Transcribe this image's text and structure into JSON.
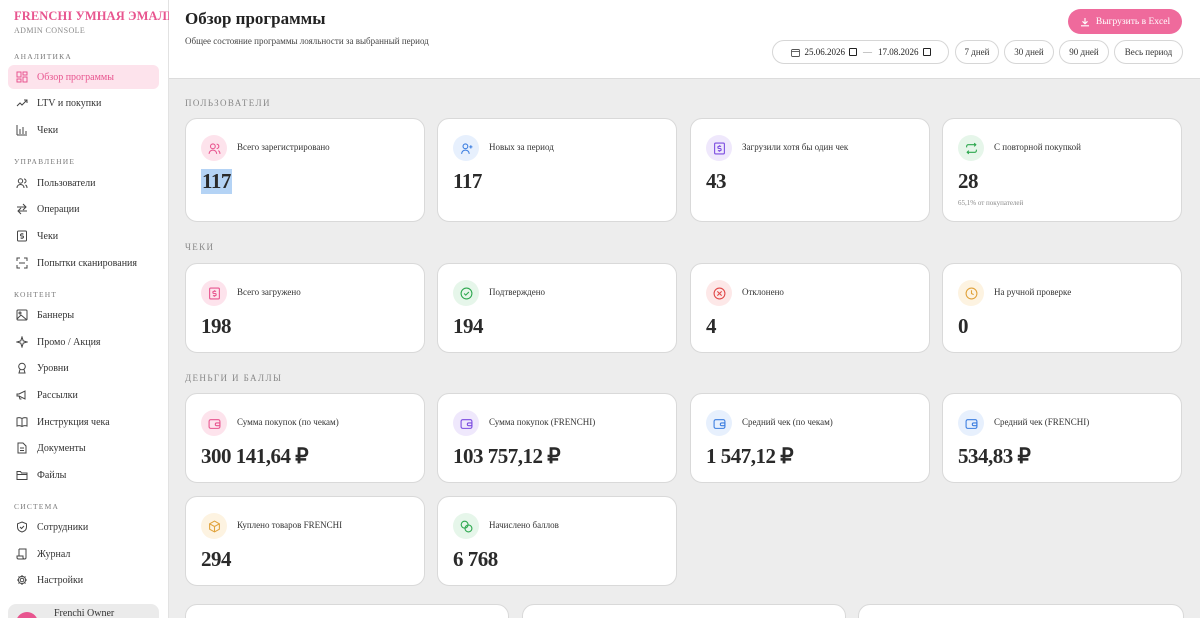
{
  "sidebar": {
    "brand": "FRENCHI УМНАЯ ЭМАЛЬ",
    "brand_sub": "ADMIN CONSOLE",
    "sections": [
      {
        "title": "АНАЛИТИКА",
        "items": [
          {
            "label": "Обзор программы",
            "icon": "dashboard-icon",
            "active": true
          },
          {
            "label": "LTV и покупки",
            "icon": "trend-up-icon"
          },
          {
            "label": "Чеки",
            "icon": "bar-chart-icon"
          }
        ]
      },
      {
        "title": "УПРАВЛЕНИЕ",
        "items": [
          {
            "label": "Пользователи",
            "icon": "users-icon"
          },
          {
            "label": "Операции",
            "icon": "arrows-swap-icon"
          },
          {
            "label": "Чеки",
            "icon": "receipt-icon"
          },
          {
            "label": "Попытки сканирования",
            "icon": "scan-icon"
          }
        ]
      },
      {
        "title": "КОНТЕНТ",
        "items": [
          {
            "label": "Баннеры",
            "icon": "image-icon"
          },
          {
            "label": "Промо / Акция",
            "icon": "sparkle-icon"
          },
          {
            "label": "Уровни",
            "icon": "award-icon"
          },
          {
            "label": "Рассылки",
            "icon": "megaphone-icon"
          },
          {
            "label": "Инструкция чека",
            "icon": "book-icon"
          },
          {
            "label": "Документы",
            "icon": "document-icon"
          },
          {
            "label": "Файлы",
            "icon": "folder-icon"
          }
        ]
      },
      {
        "title": "СИСТЕМА",
        "items": [
          {
            "label": "Сотрудники",
            "icon": "shield-icon"
          },
          {
            "label": "Журнал",
            "icon": "scroll-icon"
          },
          {
            "label": "Настройки",
            "icon": "gear-icon"
          }
        ]
      }
    ],
    "user_name": "Frenchi Owner"
  },
  "header": {
    "title": "Обзор программы",
    "subtitle": "Общее состояние программы лояльности за выбранный период",
    "export_label": "Выгрузить в Excel",
    "date_from": "25.06.2026",
    "date_to": "17.08.2026",
    "date_sep": "—",
    "presets": [
      "7 дней",
      "30 дней",
      "90 дней",
      "Весь период"
    ]
  },
  "groups": {
    "users": {
      "title": "ПОЛЬЗОВАТЕЛИ",
      "cards": [
        {
          "label": "Всего зарегистрировано",
          "value": "117",
          "icon": "users-icon",
          "tint": "#fde3ec",
          "color": "#e8558f"
        },
        {
          "label": "Новых за период",
          "value": "117",
          "icon": "user-plus-icon",
          "tint": "#e7f0fd",
          "color": "#3b7de0"
        },
        {
          "label": "Загрузили хотя бы один чек",
          "value": "43",
          "icon": "receipt-icon",
          "tint": "#efe8fc",
          "color": "#7b4be0"
        },
        {
          "label": "С повторной покупкой",
          "value": "28",
          "icon": "repeat-icon",
          "tint": "#e6f6ea",
          "color": "#2ea84f",
          "note": "65,1% от покупателей"
        }
      ]
    },
    "receipts": {
      "title": "ЧЕКИ",
      "cards": [
        {
          "label": "Всего загружено",
          "value": "198",
          "icon": "receipt-icon",
          "tint": "#fde3ec",
          "color": "#e8558f"
        },
        {
          "label": "Подтверждено",
          "value": "194",
          "icon": "check-circle-icon",
          "tint": "#e6f6ea",
          "color": "#2ea84f"
        },
        {
          "label": "Отклонено",
          "value": "4",
          "icon": "x-circle-icon",
          "tint": "#fde8e8",
          "color": "#e04848"
        },
        {
          "label": "На ручной проверке",
          "value": "0",
          "icon": "clock-icon",
          "tint": "#fdf3e1",
          "color": "#e0a23b"
        }
      ]
    },
    "money": {
      "title": "ДЕНЬГИ И БАЛЛЫ",
      "cards": [
        {
          "label": "Сумма покупок (по чекам)",
          "value": "300 141,64 ₽",
          "icon": "wallet-icon",
          "tint": "#fde3ec",
          "color": "#e8558f"
        },
        {
          "label": "Сумма покупок (FRENCHI)",
          "value": "103 757,12 ₽",
          "icon": "wallet-icon",
          "tint": "#efe8fc",
          "color": "#7b4be0"
        },
        {
          "label": "Средний чек (по чекам)",
          "value": "1 547,12 ₽",
          "icon": "wallet-icon",
          "tint": "#e7f0fd",
          "color": "#3b7de0"
        },
        {
          "label": "Средний чек (FRENCHI)",
          "value": "534,83 ₽",
          "icon": "wallet-icon",
          "tint": "#e7f0fd",
          "color": "#3b7de0"
        },
        {
          "label": "Куплено товаров FRENCHI",
          "value": "294",
          "icon": "box-icon",
          "tint": "#fdf3e1",
          "color": "#e0a23b"
        },
        {
          "label": "Начислено баллов",
          "value": "6 768",
          "icon": "coins-icon",
          "tint": "#e6f6ea",
          "color": "#2ea84f"
        }
      ]
    }
  }
}
